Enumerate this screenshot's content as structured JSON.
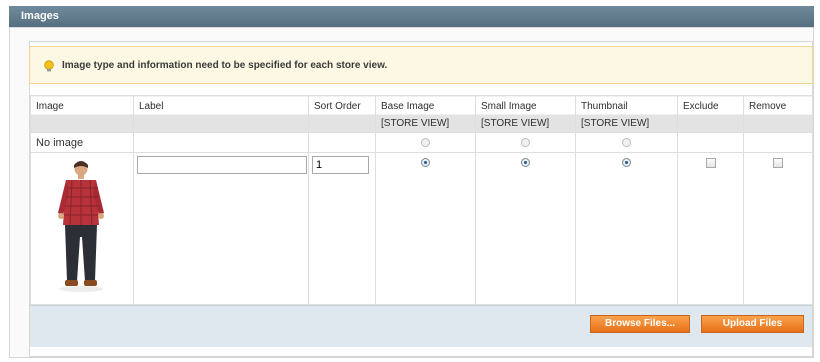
{
  "section": {
    "title": "Images"
  },
  "notice": {
    "text": "Image type and information need to be specified for each store view."
  },
  "table": {
    "columns": [
      {
        "label": "Image",
        "sub": ""
      },
      {
        "label": "Label",
        "sub": ""
      },
      {
        "label": "Sort Order",
        "sub": ""
      },
      {
        "label": "Base Image",
        "sub": "[STORE VIEW]"
      },
      {
        "label": "Small Image",
        "sub": "[STORE VIEW]"
      },
      {
        "label": "Thumbnail",
        "sub": "[STORE VIEW]"
      },
      {
        "label": "Exclude",
        "sub": ""
      },
      {
        "label": "Remove",
        "sub": ""
      }
    ],
    "no_image_row": {
      "label": "No image",
      "base_checked": false,
      "small_checked": false,
      "thumbnail_checked": false
    },
    "image_row": {
      "label_value": "",
      "sort_order": "1",
      "base_checked": true,
      "small_checked": true,
      "thumbnail_checked": true,
      "exclude_checked": false,
      "remove_checked": false
    }
  },
  "buttons": {
    "browse": "Browse Files...",
    "upload": "Upload Files"
  },
  "colors": {
    "header": "#5f7a8c",
    "notice_bg": "#fcf8e3",
    "button": "#ee7d22",
    "footer": "#dfe8ee"
  }
}
